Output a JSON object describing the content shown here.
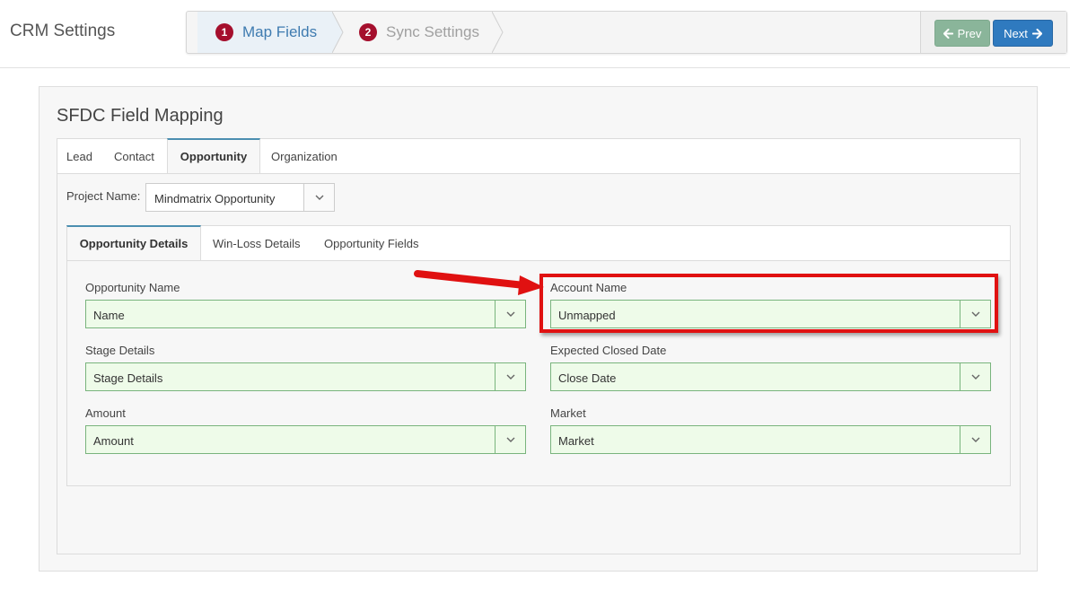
{
  "header": {
    "title": "CRM Settings",
    "steps": [
      {
        "number": "1",
        "label": "Map Fields",
        "active": true
      },
      {
        "number": "2",
        "label": "Sync Settings",
        "active": false
      }
    ],
    "prev_label": "Prev",
    "next_label": "Next"
  },
  "card": {
    "title": "SFDC Field Mapping",
    "tabs": [
      "Lead",
      "Contact",
      "Opportunity",
      "Organization"
    ],
    "active_tab": "Opportunity",
    "project_label": "Project Name:",
    "project_value": "Mindmatrix Opportunity",
    "inner_tabs": [
      "Opportunity Details",
      "Win-Loss Details",
      "Opportunity Fields"
    ],
    "active_inner_tab": "Opportunity Details",
    "fields": [
      {
        "label": "Opportunity Name",
        "value": "Name"
      },
      {
        "label": "Account Name",
        "value": "Unmapped"
      },
      {
        "label": "Stage Details",
        "value": "Stage Details"
      },
      {
        "label": "Expected Closed Date",
        "value": "Close Date"
      },
      {
        "label": "Amount",
        "value": "Amount"
      },
      {
        "label": "Market",
        "value": "Market"
      }
    ]
  },
  "colors": {
    "step_badge": "#a50f2d",
    "active_step_text": "#3e7bb0",
    "prev_button": "#8ab59a",
    "next_button": "#2f7abf",
    "mapped_field_bg": "#eefbe9",
    "mapped_field_border": "#79b47d",
    "annotation_red": "#e01111"
  }
}
